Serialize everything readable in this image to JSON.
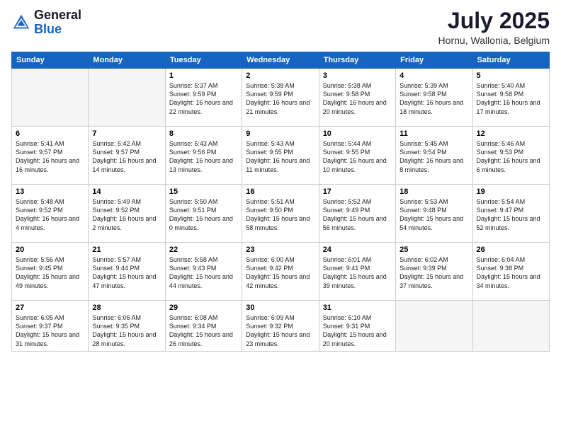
{
  "header": {
    "logo_general": "General",
    "logo_blue": "Blue",
    "month_year": "July 2025",
    "location": "Hornu, Wallonia, Belgium"
  },
  "days_of_week": [
    "Sunday",
    "Monday",
    "Tuesday",
    "Wednesday",
    "Thursday",
    "Friday",
    "Saturday"
  ],
  "weeks": [
    [
      {
        "day": "",
        "empty": true
      },
      {
        "day": "",
        "empty": true
      },
      {
        "day": "1",
        "sunrise": "5:37 AM",
        "sunset": "9:59 PM",
        "daylight": "16 hours and 22 minutes."
      },
      {
        "day": "2",
        "sunrise": "5:38 AM",
        "sunset": "9:59 PM",
        "daylight": "16 hours and 21 minutes."
      },
      {
        "day": "3",
        "sunrise": "5:38 AM",
        "sunset": "9:58 PM",
        "daylight": "16 hours and 20 minutes."
      },
      {
        "day": "4",
        "sunrise": "5:39 AM",
        "sunset": "9:58 PM",
        "daylight": "16 hours and 18 minutes."
      },
      {
        "day": "5",
        "sunrise": "5:40 AM",
        "sunset": "9:58 PM",
        "daylight": "16 hours and 17 minutes."
      }
    ],
    [
      {
        "day": "6",
        "sunrise": "5:41 AM",
        "sunset": "9:57 PM",
        "daylight": "16 hours and 16 minutes."
      },
      {
        "day": "7",
        "sunrise": "5:42 AM",
        "sunset": "9:57 PM",
        "daylight": "16 hours and 14 minutes."
      },
      {
        "day": "8",
        "sunrise": "5:43 AM",
        "sunset": "9:56 PM",
        "daylight": "16 hours and 13 minutes."
      },
      {
        "day": "9",
        "sunrise": "5:43 AM",
        "sunset": "9:55 PM",
        "daylight": "16 hours and 11 minutes."
      },
      {
        "day": "10",
        "sunrise": "5:44 AM",
        "sunset": "9:55 PM",
        "daylight": "16 hours and 10 minutes."
      },
      {
        "day": "11",
        "sunrise": "5:45 AM",
        "sunset": "9:54 PM",
        "daylight": "16 hours and 8 minutes."
      },
      {
        "day": "12",
        "sunrise": "5:46 AM",
        "sunset": "9:53 PM",
        "daylight": "16 hours and 6 minutes."
      }
    ],
    [
      {
        "day": "13",
        "sunrise": "5:48 AM",
        "sunset": "9:52 PM",
        "daylight": "16 hours and 4 minutes."
      },
      {
        "day": "14",
        "sunrise": "5:49 AM",
        "sunset": "9:52 PM",
        "daylight": "16 hours and 2 minutes."
      },
      {
        "day": "15",
        "sunrise": "5:50 AM",
        "sunset": "9:51 PM",
        "daylight": "16 hours and 0 minutes."
      },
      {
        "day": "16",
        "sunrise": "5:51 AM",
        "sunset": "9:50 PM",
        "daylight": "15 hours and 58 minutes."
      },
      {
        "day": "17",
        "sunrise": "5:52 AM",
        "sunset": "9:49 PM",
        "daylight": "15 hours and 56 minutes."
      },
      {
        "day": "18",
        "sunrise": "5:53 AM",
        "sunset": "9:48 PM",
        "daylight": "15 hours and 54 minutes."
      },
      {
        "day": "19",
        "sunrise": "5:54 AM",
        "sunset": "9:47 PM",
        "daylight": "15 hours and 52 minutes."
      }
    ],
    [
      {
        "day": "20",
        "sunrise": "5:56 AM",
        "sunset": "9:45 PM",
        "daylight": "15 hours and 49 minutes."
      },
      {
        "day": "21",
        "sunrise": "5:57 AM",
        "sunset": "9:44 PM",
        "daylight": "15 hours and 47 minutes."
      },
      {
        "day": "22",
        "sunrise": "5:58 AM",
        "sunset": "9:43 PM",
        "daylight": "15 hours and 44 minutes."
      },
      {
        "day": "23",
        "sunrise": "6:00 AM",
        "sunset": "9:42 PM",
        "daylight": "15 hours and 42 minutes."
      },
      {
        "day": "24",
        "sunrise": "6:01 AM",
        "sunset": "9:41 PM",
        "daylight": "15 hours and 39 minutes."
      },
      {
        "day": "25",
        "sunrise": "6:02 AM",
        "sunset": "9:39 PM",
        "daylight": "15 hours and 37 minutes."
      },
      {
        "day": "26",
        "sunrise": "6:04 AM",
        "sunset": "9:38 PM",
        "daylight": "15 hours and 34 minutes."
      }
    ],
    [
      {
        "day": "27",
        "sunrise": "6:05 AM",
        "sunset": "9:37 PM",
        "daylight": "15 hours and 31 minutes."
      },
      {
        "day": "28",
        "sunrise": "6:06 AM",
        "sunset": "9:35 PM",
        "daylight": "15 hours and 28 minutes."
      },
      {
        "day": "29",
        "sunrise": "6:08 AM",
        "sunset": "9:34 PM",
        "daylight": "15 hours and 26 minutes."
      },
      {
        "day": "30",
        "sunrise": "6:09 AM",
        "sunset": "9:32 PM",
        "daylight": "15 hours and 23 minutes."
      },
      {
        "day": "31",
        "sunrise": "6:10 AM",
        "sunset": "9:31 PM",
        "daylight": "15 hours and 20 minutes."
      },
      {
        "day": "",
        "empty": true
      },
      {
        "day": "",
        "empty": true
      }
    ]
  ]
}
